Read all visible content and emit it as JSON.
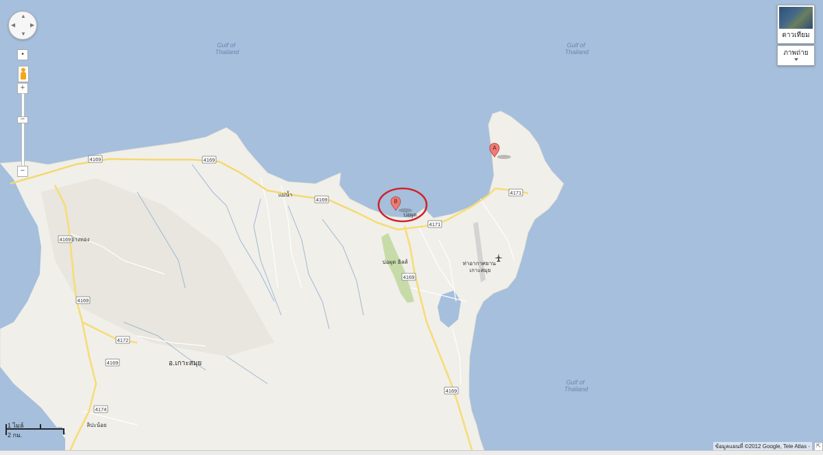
{
  "map": {
    "water_labels": [
      "Gulf of\nThailand",
      "Gulf of\nThailand",
      "Gulf of\nThailand"
    ],
    "places": {
      "mae_nam": "แม่น้ำ",
      "bophut": "บ่อผุด",
      "bophut_hills": "บ่อผุด ฮิลส์",
      "airport": "ท่าอากาศยาน\nเกาะสมุย",
      "ang_thong": "อ่างทอง",
      "district": "อ.เกาะสมุย",
      "lipa_noi": "ลิปะน้อย"
    },
    "routes": [
      "4169",
      "4169",
      "4169",
      "4171",
      "4171",
      "4169",
      "4169",
      "4172",
      "4169",
      "4174",
      "4169",
      "4169"
    ],
    "markers": {
      "a": "A",
      "b": "B"
    },
    "highlight_color": "#d1232a"
  },
  "controls": {
    "zoom_in": "+",
    "zoom_out": "−",
    "map_type_label": "ดาวเทียม",
    "photos_label": "ภาพถ่าย"
  },
  "scale": {
    "imperial": "1 ไมล์",
    "metric": "2 กม."
  },
  "attribution": "ข้อมูลแผนที่ ©2012 Google, Tele Atlas -",
  "colors": {
    "sea": "#a5bfdd",
    "land": "#f0efe9",
    "road": "#f7dc77",
    "park": "#c7dba8"
  }
}
